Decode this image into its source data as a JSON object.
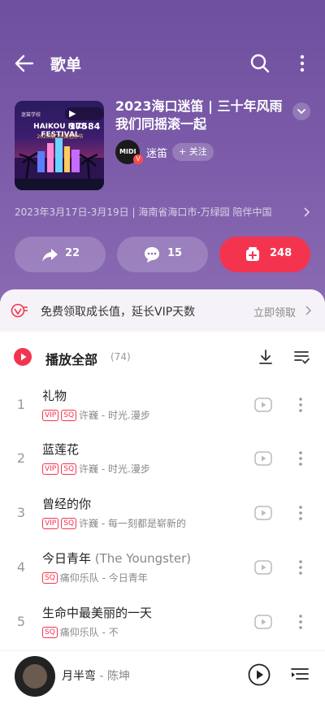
{
  "header": {
    "title": "歌单",
    "back_icon": "arrow-left-icon",
    "search_icon": "search-icon",
    "more_icon": "more-vertical-icon"
  },
  "playlist": {
    "cover_play_count": "▶ 17584",
    "cover_text_top": "迷笛学校",
    "cover_text_title": "HAIKOU MIDI FESTIVAL",
    "cover_text_sub": "2023海口迷笛音乐节",
    "title": "2023海口迷笛 | 三十年风雨 我们同摇滚一起",
    "creator_name": "迷笛",
    "creator_avatar_label": "MIDI",
    "follow_label": "+ 关注",
    "description": "2023年3月17日-3月19日 | 海南省海口市-万绿园  陪伴中国"
  },
  "actions": {
    "share_count": "22",
    "comment_count": "15",
    "collect_count": "248"
  },
  "vip_banner": {
    "text": "免费领取成长值，延长VIP天数",
    "link": "立即领取"
  },
  "play_all": {
    "label": "播放全部",
    "count": "(74)"
  },
  "songs": [
    {
      "index": "1",
      "title": "礼物",
      "alt": "",
      "tags": [
        "VIP",
        "SQ"
      ],
      "artist": "许巍 - 时光.漫步"
    },
    {
      "index": "2",
      "title": "蓝莲花",
      "alt": "",
      "tags": [
        "VIP",
        "SQ"
      ],
      "artist": "许巍 - 时光.漫步"
    },
    {
      "index": "3",
      "title": "曾经的你",
      "alt": "",
      "tags": [
        "VIP",
        "SQ"
      ],
      "artist": "许巍 - 每一刻都是崭新的"
    },
    {
      "index": "4",
      "title": "今日青年 ",
      "alt": "(The Youngster)",
      "tags": [
        "SQ"
      ],
      "artist": "痛仰乐队 - 今日青年"
    },
    {
      "index": "5",
      "title": "生命中最美丽的一天",
      "alt": "",
      "tags": [
        "SQ"
      ],
      "artist": "痛仰乐队 - 不"
    }
  ],
  "mini_player": {
    "title": "月半弯",
    "artist": " - 陈坤"
  },
  "colors": {
    "accent": "#f4344f",
    "hero_bg": "#7a5aa8"
  }
}
